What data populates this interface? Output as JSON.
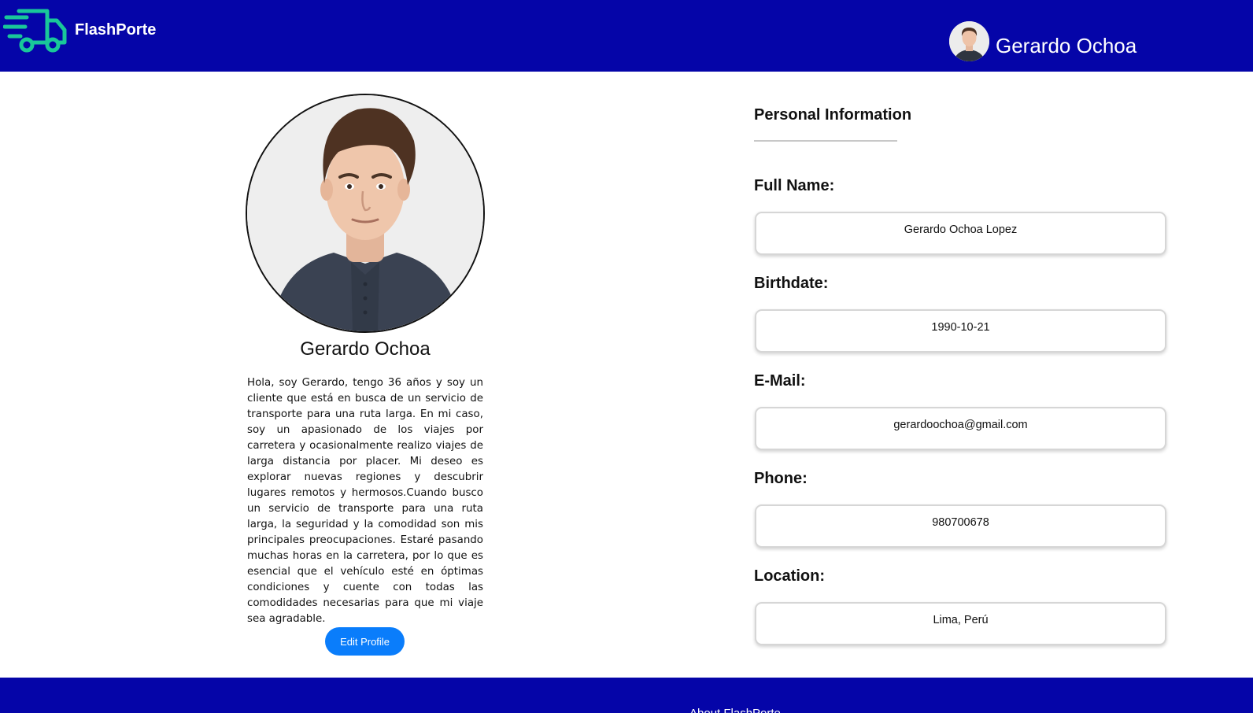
{
  "header": {
    "brand": "FlashPorte",
    "user_name": "Gerardo Ochoa",
    "logo_icon": "delivery-truck-icon",
    "accent_color": "#0505a8",
    "logo_color": "#19c79a"
  },
  "profile": {
    "name": "Gerardo Ochoa",
    "bio": "Hola, soy Gerardo, tengo 36 años y soy un cliente que está en busca de un servicio de transporte para una ruta larga. En mi caso, soy un apasionado de los viajes por carretera y ocasionalmente realizo viajes de larga distancia por placer. Mi deseo es explorar nuevas regiones y descubrir lugares remotos y hermosos.Cuando busco un servicio de transporte para una ruta larga, la seguridad y la comodidad son mis principales preocupaciones. Estaré pasando muchas horas en la carretera, por lo que es esencial que el vehículo esté en óptimas condiciones y cuente con todas las comodidades necesarias para que mi viaje sea agradable.",
    "edit_label": "Edit Profile",
    "button_color": "#0a7dfb"
  },
  "personal_info": {
    "title": "Personal Information",
    "fields": [
      {
        "label": "Full Name:",
        "value": "Gerardo Ochoa Lopez"
      },
      {
        "label": "Birthdate:",
        "value": "1990-10-21"
      },
      {
        "label": "E-Mail:",
        "value": "gerardoochoa@gmail.com"
      },
      {
        "label": "Phone:",
        "value": "980700678"
      },
      {
        "label": "Location:",
        "value": "Lima, Perú"
      }
    ]
  },
  "footer": {
    "link": "About FlashPorte"
  }
}
